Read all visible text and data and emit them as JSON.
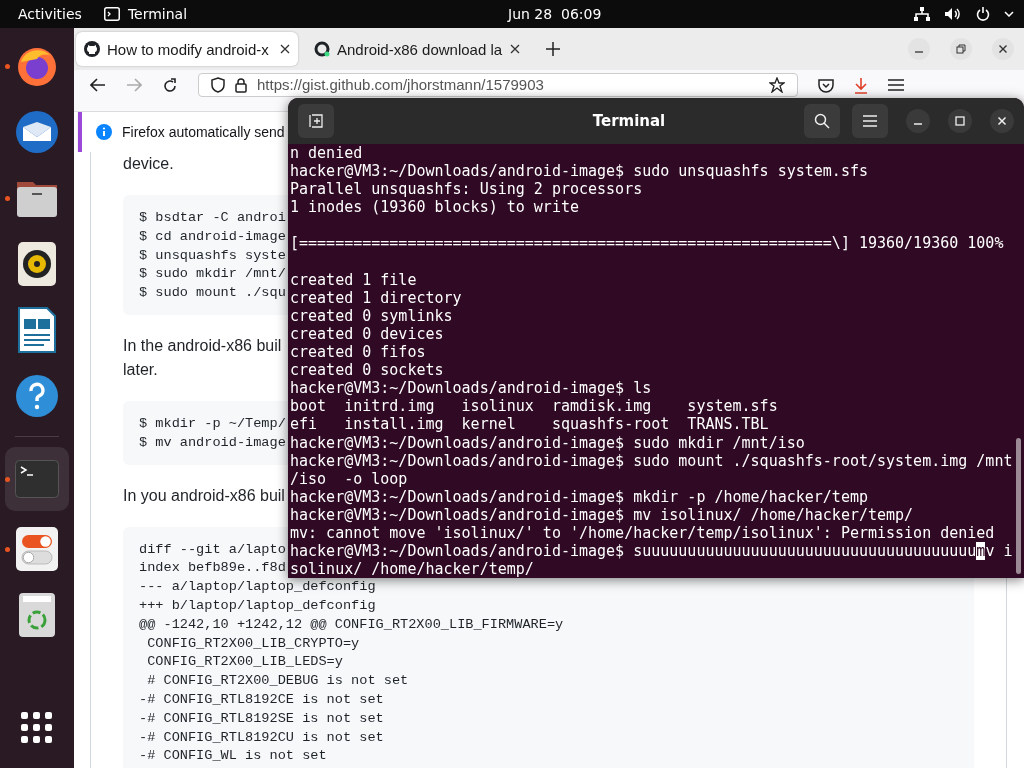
{
  "top_bar": {
    "activities": "Activities",
    "app_name": "Terminal",
    "date": "Jun 28",
    "time": "06:09"
  },
  "dock": {
    "items": [
      {
        "kind": "firefox",
        "running": true,
        "selected": false
      },
      {
        "kind": "mail",
        "running": false,
        "selected": false
      },
      {
        "kind": "files",
        "running": true,
        "selected": false
      },
      {
        "kind": "speaker",
        "running": false,
        "selected": false
      },
      {
        "kind": "document",
        "running": false,
        "selected": false
      },
      {
        "kind": "help",
        "running": false,
        "selected": false
      },
      {
        "kind": "separator"
      },
      {
        "kind": "terminal",
        "running": true,
        "selected": true
      },
      {
        "kind": "toggles",
        "running": true,
        "selected": false
      },
      {
        "kind": "trash",
        "running": false,
        "selected": false
      }
    ]
  },
  "browser": {
    "tabs": [
      {
        "label": "How to modify android-x",
        "selected": true
      },
      {
        "label": "Android-x86 download la",
        "selected": false
      }
    ],
    "url": "https://gist.github.com/jhorstmann/1579903",
    "notification": "Firefox automatically send",
    "page": [
      {
        "kind": "paragraph",
        "lines": [
          "device."
        ]
      },
      {
        "kind": "code",
        "lines": [
          "$ bsdtar -C androi",
          "$ cd android-image",
          "$ unsquashfs syste",
          "$ sudo mkdir /mnt/",
          "$ sudo mount ./squ"
        ]
      },
      {
        "kind": "paragraph",
        "lines": [
          "In the android-x86 buil",
          "later."
        ]
      },
      {
        "kind": "code",
        "lines": [
          "$ mkdir -p ~/Temp/",
          "$ mv android-image"
        ]
      },
      {
        "kind": "paragraph",
        "lines": [
          "In you android-x86 buil"
        ]
      },
      {
        "kind": "code",
        "lines": [
          "diff --git a/lapto",
          "index befb89e..f8d",
          "--- a/laptop/laptop_defconfig",
          "+++ b/laptop/laptop_defconfig",
          "@@ -1242,10 +1242,12 @@ CONFIG_RT2X00_LIB_FIRMWARE=y",
          " CONFIG_RT2X00_LIB_CRYPTO=y",
          " CONFIG_RT2X00_LIB_LEDS=y",
          " # CONFIG_RT2X00_DEBUG is not set",
          "-# CONFIG_RTL8192CE is not set",
          "-# CONFIG_RTL8192SE is not set",
          "-# CONFIG_RTL8192CU is not set",
          "-# CONFIG_WL is not set"
        ]
      }
    ]
  },
  "terminal": {
    "title": "Terminal",
    "lines": [
      {
        "kind": "text",
        "text": "n denied"
      },
      {
        "kind": "text",
        "text": "hacker@VM3:~/Downloads/android-image$ sudo unsquashfs system.sfs"
      },
      {
        "kind": "text",
        "text": "Parallel unsquashfs: Using 2 processors"
      },
      {
        "kind": "text",
        "text": "1 inodes (19360 blocks) to write"
      },
      {
        "kind": "blank"
      },
      {
        "kind": "text",
        "text": "[===========================================================\\] 19360/19360 100%"
      },
      {
        "kind": "blank"
      },
      {
        "kind": "text",
        "text": "created 1 file"
      },
      {
        "kind": "text",
        "text": "created 1 directory"
      },
      {
        "kind": "text",
        "text": "created 0 symlinks"
      },
      {
        "kind": "text",
        "text": "created 0 devices"
      },
      {
        "kind": "text",
        "text": "created 0 fifos"
      },
      {
        "kind": "text",
        "text": "created 0 sockets"
      },
      {
        "kind": "text",
        "text": "hacker@VM3:~/Downloads/android-image$ ls"
      },
      {
        "kind": "text",
        "text": "boot  initrd.img   isolinux  ramdisk.img    system.sfs"
      },
      {
        "kind": "text",
        "text": "efi   install.img  kernel    squashfs-root  TRANS.TBL"
      },
      {
        "kind": "text",
        "text": "hacker@VM3:~/Downloads/android-image$ sudo mkdir /mnt/iso"
      },
      {
        "kind": "text",
        "text": "hacker@VM3:~/Downloads/android-image$ sudo mount ./squashfs-root/system.img /mnt"
      },
      {
        "kind": "text",
        "text": "/iso  -o loop"
      },
      {
        "kind": "text",
        "text": "hacker@VM3:~/Downloads/android-image$ mkdir -p /home/hacker/temp"
      },
      {
        "kind": "text",
        "text": "hacker@VM3:~/Downloads/android-image$ mv isolinux/ /home/hacker/temp/"
      },
      {
        "kind": "text",
        "text": "mv: cannot move 'isolinux/' to '/home/hacker/temp/isolinux': Permission denied"
      },
      {
        "kind": "cursor",
        "before": "hacker@VM3:~/Downloads/android-image$ suuuuuuuuuuuuuuuuuuuuuuuuuuuuuuuuuuuuu",
        "cursor": "m",
        "after": "v i"
      },
      {
        "kind": "text",
        "text": "solinux/ /home/hacker/temp/"
      }
    ]
  }
}
